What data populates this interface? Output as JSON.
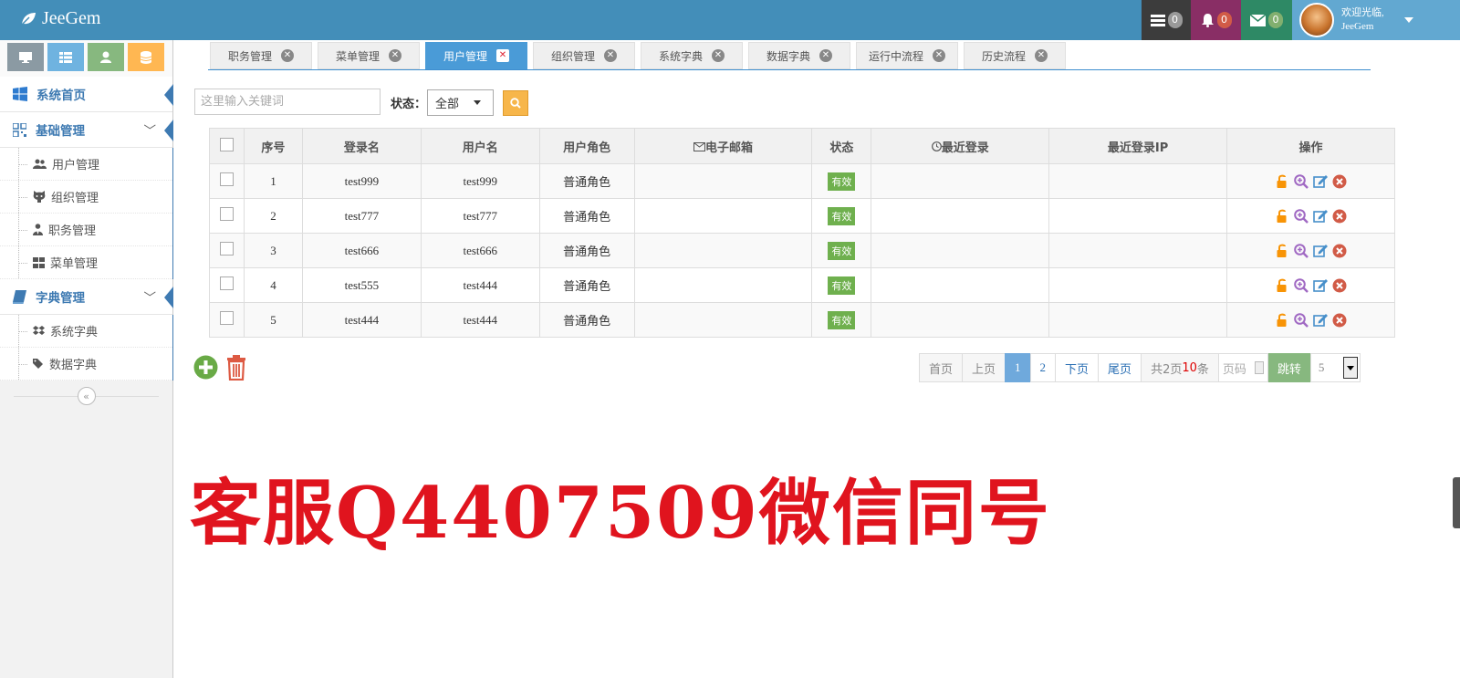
{
  "app": {
    "brand": "JeeGem"
  },
  "navbar": {
    "tasks_count": "0",
    "notifications_count": "0",
    "messages_count": "0",
    "welcome": "欢迎光临,",
    "username": "JeeGem",
    "colors": {
      "bar": "#438eb9",
      "tasks": "#3c3c3c",
      "bell": "#892e65",
      "mail": "#2e8965",
      "user": "#62a8d1"
    }
  },
  "sidebar": {
    "shortcut_icons": [
      "desktop-icon",
      "grid-icon",
      "user-icon",
      "database-icon"
    ],
    "menus": [
      {
        "label": "系统首页",
        "icon": "windows-icon"
      },
      {
        "label": "基础管理",
        "icon": "qrcode-icon",
        "children": [
          {
            "label": "用户管理",
            "icon": "users-icon"
          },
          {
            "label": "组织管理",
            "icon": "github-icon"
          },
          {
            "label": "职务管理",
            "icon": "user-tie-icon"
          },
          {
            "label": "菜单管理",
            "icon": "th-large-icon"
          }
        ]
      },
      {
        "label": "字典管理",
        "icon": "book-icon",
        "children": [
          {
            "label": "系统字典",
            "icon": "dropbox-icon"
          },
          {
            "label": "数据字典",
            "icon": "tags-icon"
          }
        ]
      }
    ]
  },
  "tabs": [
    {
      "label": "职务管理"
    },
    {
      "label": "菜单管理"
    },
    {
      "label": "用户管理",
      "active": true
    },
    {
      "label": "组织管理"
    },
    {
      "label": "系统字典"
    },
    {
      "label": "数据字典"
    },
    {
      "label": "运行中流程"
    },
    {
      "label": "历史流程"
    }
  ],
  "search": {
    "placeholder": "这里输入关键词",
    "status_label": "状态：",
    "status_value": "全部"
  },
  "table": {
    "headers": [
      "序号",
      "登录名",
      "用户名",
      "用户角色",
      "电子邮箱",
      "状态",
      "最近登录",
      "最近登录IP",
      "操作"
    ],
    "rows": [
      {
        "no": "1",
        "login": "test999",
        "name": "test999",
        "role": "普通角色",
        "email": "",
        "status": "有效",
        "last_login": "",
        "last_ip": ""
      },
      {
        "no": "2",
        "login": "test777",
        "name": "test777",
        "role": "普通角色",
        "email": "",
        "status": "有效",
        "last_login": "",
        "last_ip": ""
      },
      {
        "no": "3",
        "login": "test666",
        "name": "test666",
        "role": "普通角色",
        "email": "",
        "status": "有效",
        "last_login": "",
        "last_ip": ""
      },
      {
        "no": "4",
        "login": "test555",
        "name": "test444",
        "role": "普通角色",
        "email": "",
        "status": "有效",
        "last_login": "",
        "last_ip": ""
      },
      {
        "no": "5",
        "login": "test444",
        "name": "test444",
        "role": "普通角色",
        "email": "",
        "status": "有效",
        "last_login": "",
        "last_ip": ""
      }
    ]
  },
  "pager": {
    "first": "首页",
    "prev": "上页",
    "pages": [
      "1",
      "2"
    ],
    "current": "1",
    "next": "下页",
    "last": "尾页",
    "total_prefix": "共2页",
    "total_count": "10",
    "total_suffix": "条",
    "page_input_placeholder": "页码",
    "jump": "跳转",
    "page_size": "5"
  },
  "watermark": "客服Q4407509微信同号"
}
